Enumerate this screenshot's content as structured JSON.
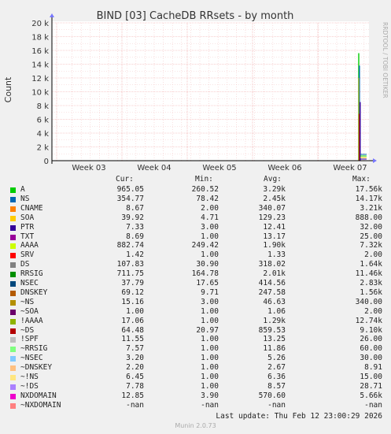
{
  "chart_data": {
    "type": "area",
    "title": "BIND [03] CacheDB RRsets - by month",
    "ylabel": "Count",
    "xlabel": "",
    "x_ticks": [
      "Week 03",
      "Week 04",
      "Week 05",
      "Week 06",
      "Week 07"
    ],
    "y_ticks": [
      "0",
      "2 k",
      "4 k",
      "6 k",
      "8 k",
      "10 k",
      "12 k",
      "14 k",
      "16 k",
      "18 k",
      "20 k"
    ],
    "ylim": [
      0,
      20000
    ],
    "grid": true,
    "spike_series": [
      {
        "name": "A",
        "color": "#00cc00",
        "value": 15600
      },
      {
        "name": "NS",
        "color": "#0066b3",
        "value": 13800
      },
      {
        "name": "CNAME",
        "color": "#ff8000",
        "value": 3100
      },
      {
        "name": "!AAAA",
        "color": "#8fa82a",
        "value": 12000
      },
      {
        "name": "~DS",
        "color": "#cc0000",
        "value": 6800
      },
      {
        "name": "RRSIG",
        "color": "#330099",
        "value": 8500
      }
    ]
  },
  "side_label": "RRDTOOL / TOBI OETIKER",
  "legend_headers": {
    "cur": "Cur:",
    "min": "Min:",
    "avg": "Avg:",
    "max": "Max:"
  },
  "legend": [
    {
      "name": "A",
      "color": "#00cc00",
      "cur": "965.05",
      "min": "260.52",
      "avg": "3.29k",
      "max": "17.56k"
    },
    {
      "name": "NS",
      "color": "#0066b3",
      "cur": "354.77",
      "min": "78.42",
      "avg": "2.45k",
      "max": "14.17k"
    },
    {
      "name": "CNAME",
      "color": "#ff8000",
      "cur": "8.67",
      "min": "2.00",
      "avg": "340.07",
      "max": "3.21k"
    },
    {
      "name": "SOA",
      "color": "#ffcc00",
      "cur": "39.92",
      "min": "4.71",
      "avg": "129.23",
      "max": "888.00"
    },
    {
      "name": "PTR",
      "color": "#330099",
      "cur": "7.33",
      "min": "3.00",
      "avg": "12.41",
      "max": "32.00"
    },
    {
      "name": "TXT",
      "color": "#990099",
      "cur": "8.69",
      "min": "1.00",
      "avg": "13.17",
      "max": "25.00"
    },
    {
      "name": "AAAA",
      "color": "#ccff00",
      "cur": "882.74",
      "min": "249.42",
      "avg": "1.90k",
      "max": "7.32k"
    },
    {
      "name": "SRV",
      "color": "#ff0000",
      "cur": "1.42",
      "min": "1.00",
      "avg": "1.33",
      "max": "2.00"
    },
    {
      "name": "DS",
      "color": "#808080",
      "cur": "107.83",
      "min": "30.90",
      "avg": "318.02",
      "max": "1.64k"
    },
    {
      "name": "RRSIG",
      "color": "#008f00",
      "cur": "711.75",
      "min": "164.78",
      "avg": "2.01k",
      "max": "11.46k"
    },
    {
      "name": "NSEC",
      "color": "#00487d",
      "cur": "37.79",
      "min": "17.65",
      "avg": "414.56",
      "max": "2.83k"
    },
    {
      "name": "DNSKEY",
      "color": "#b35a00",
      "cur": "69.12",
      "min": "9.71",
      "avg": "247.58",
      "max": "1.56k"
    },
    {
      "name": "~NS",
      "color": "#b38f00",
      "cur": "15.16",
      "min": "3.00",
      "avg": "46.63",
      "max": "340.00"
    },
    {
      "name": "~SOA",
      "color": "#6b006b",
      "cur": "1.00",
      "min": "1.00",
      "avg": "1.06",
      "max": "2.00"
    },
    {
      "name": "!AAAA",
      "color": "#8fb300",
      "cur": "17.06",
      "min": "1.00",
      "avg": "1.29k",
      "max": "12.74k"
    },
    {
      "name": "~DS",
      "color": "#b30000",
      "cur": "64.48",
      "min": "20.97",
      "avg": "859.53",
      "max": "9.10k"
    },
    {
      "name": "!SPF",
      "color": "#bebebe",
      "cur": "11.55",
      "min": "1.00",
      "avg": "13.25",
      "max": "26.00"
    },
    {
      "name": "~RRSIG",
      "color": "#80ff80",
      "cur": "7.57",
      "min": "1.00",
      "avg": "11.86",
      "max": "60.00"
    },
    {
      "name": "~NSEC",
      "color": "#80c9ff",
      "cur": "3.20",
      "min": "1.00",
      "avg": "5.26",
      "max": "30.00"
    },
    {
      "name": "~DNSKEY",
      "color": "#ffc080",
      "cur": "2.20",
      "min": "1.00",
      "avg": "2.67",
      "max": "8.91"
    },
    {
      "name": "~!NS",
      "color": "#ffe680",
      "cur": "6.45",
      "min": "1.00",
      "avg": "6.36",
      "max": "15.00"
    },
    {
      "name": "~!DS",
      "color": "#aa80ff",
      "cur": "7.78",
      "min": "1.00",
      "avg": "8.57",
      "max": "28.71"
    },
    {
      "name": "NXDOMAIN",
      "color": "#ee00cc",
      "cur": "12.85",
      "min": "3.90",
      "avg": "570.60",
      "max": "5.66k"
    },
    {
      "name": "~NXDOMAIN",
      "color": "#ff8080",
      "cur": "-nan",
      "min": "-nan",
      "avg": "-nan",
      "max": "-nan"
    }
  ],
  "last_update": "Last update: Thu Feb 12 23:00:29 2026",
  "footer": "Munin 2.0.73"
}
